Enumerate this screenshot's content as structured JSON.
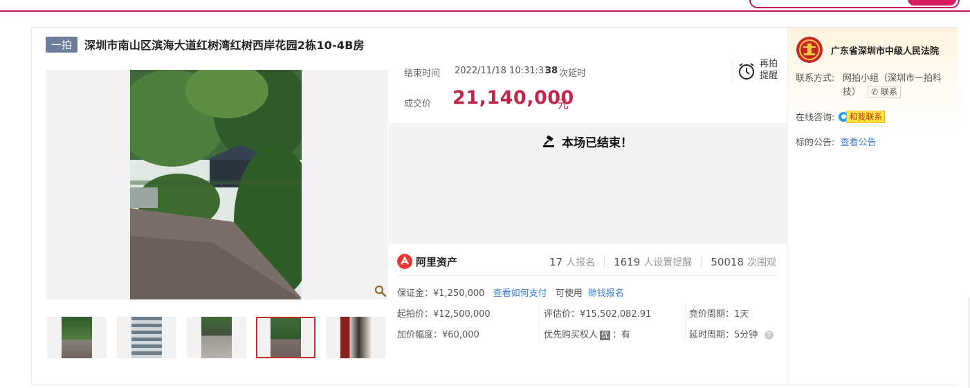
{
  "header": {
    "accent_color": "#c2185b"
  },
  "lot": {
    "tag": "一拍",
    "title": "深圳市南山区滨海大道红树湾红树西岸花园2栋10-4B房"
  },
  "auction": {
    "end_label": "结束时间",
    "end_time": "2022/11/18 10:31:31",
    "delay_count": "38",
    "delay_label": "次延时",
    "remind_label": "再拍提醒",
    "price_label": "成交价",
    "price": "21,140,000",
    "price_unit": "元",
    "ended_text": "本场已结束！"
  },
  "platform": {
    "logo_text": "阿里资产",
    "stats": [
      {
        "num": "17",
        "label": "人报名"
      },
      {
        "num": "1619",
        "label": "人设置提醒"
      },
      {
        "num": "50018",
        "label": "次围观"
      }
    ]
  },
  "deposit": {
    "label": "保证金：¥1,250,000",
    "how_pay": "查看如何支付",
    "usable": "可使用",
    "credit_signup": "赊钱报名"
  },
  "details": {
    "start_price": "起拍价：¥12,500,000",
    "increment": "加价幅度：¥60,000",
    "appraisal": "评估价：¥15,502,082.91",
    "priority_label": "优先购买权人",
    "priority_badge": "优",
    "priority_value": "：有",
    "bid_cycle": "竞价周期：1天",
    "delay_cycle": "延时周期：5分钟",
    "help_icon": "?"
  },
  "side": {
    "court": "广东省深圳市中级人民法院",
    "contact_label": "联系方式:",
    "contact_value": "网拍小组（深圳市一拍科技）",
    "contact_btn": "联系",
    "consult_label": "在线咨询:",
    "chat_text": "和我联系",
    "notice_label": "标的公告:",
    "notice_link": "查看公告"
  },
  "icons": {
    "zoom": "magnifier-icon",
    "clock": "alarm-clock-icon",
    "gavel": "gavel-icon",
    "emblem": "court-emblem-icon",
    "phone": "phone-icon"
  },
  "gallery": {
    "selected_index": 3,
    "count": 5
  }
}
